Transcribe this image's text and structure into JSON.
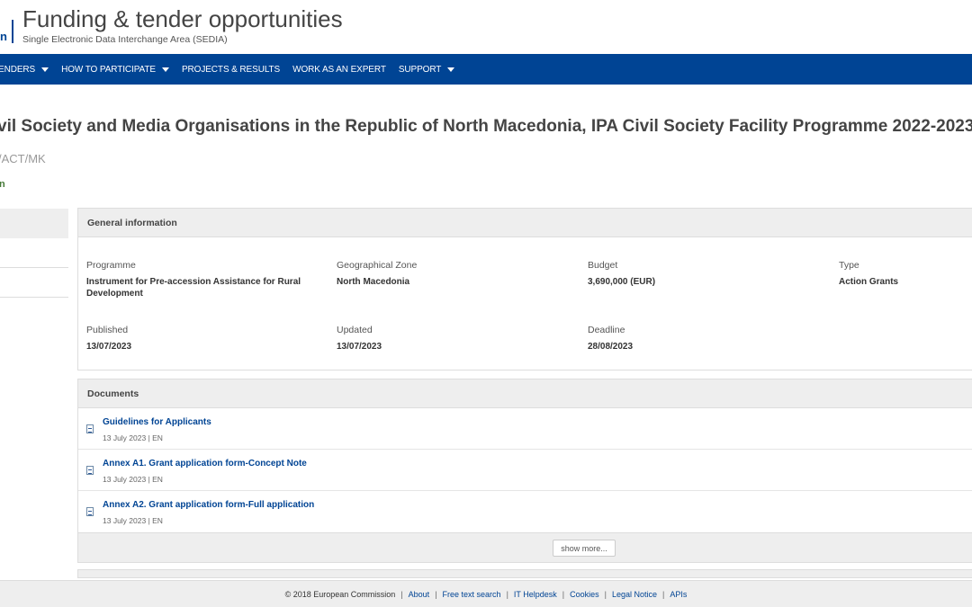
{
  "header": {
    "logo_fragment": "n",
    "title": "Funding & tender opportunities",
    "subtitle": "Single Electronic Data Interchange Area (SEDIA)"
  },
  "nav": {
    "items": [
      {
        "label": "ENDERS",
        "dropdown": true
      },
      {
        "label": "HOW TO PARTICIPATE",
        "dropdown": true
      },
      {
        "label": "PROJECTS & RESULTS",
        "dropdown": false
      },
      {
        "label": "WORK AS AN EXPERT",
        "dropdown": false
      },
      {
        "label": "SUPPORT",
        "dropdown": true
      }
    ]
  },
  "call": {
    "title": "vil Society and Media Organisations in the Republic of North Macedonia, IPA Civil Society Facility Programme 2022-2023",
    "identifier": "/ACT/MK",
    "status": "n"
  },
  "general_info": {
    "heading": "General information",
    "programme_label": "Programme",
    "programme_value": "Instrument for Pre-accession Assistance for Rural Development",
    "zone_label": "Geographical Zone",
    "zone_value": "North Macedonia",
    "budget_label": "Budget",
    "budget_value": "3,690,000 (EUR)",
    "type_label": "Type",
    "type_value": "Action Grants",
    "published_label": "Published",
    "published_value": "13/07/2023",
    "updated_label": "Updated",
    "updated_value": "13/07/2023",
    "deadline_label": "Deadline",
    "deadline_value": "28/08/2023"
  },
  "documents": {
    "heading": "Documents",
    "items": [
      {
        "title": "Guidelines for Applicants",
        "meta": "13 July 2023 | EN"
      },
      {
        "title": "Annex A1. Grant application form-Concept Note",
        "meta": "13 July 2023 | EN"
      },
      {
        "title": "Annex A2. Grant application form-Full application",
        "meta": "13 July 2023 | EN"
      }
    ],
    "show_more": "show more..."
  },
  "footer": {
    "copyright": "© 2018 European Commission",
    "links": [
      "About",
      "Free text search",
      "IT Helpdesk",
      "Cookies",
      "Legal Notice",
      "APIs"
    ]
  },
  "colors": {
    "brand_blue": "#004494",
    "status_green": "#467a39",
    "panel_grey": "#eeeeee"
  }
}
